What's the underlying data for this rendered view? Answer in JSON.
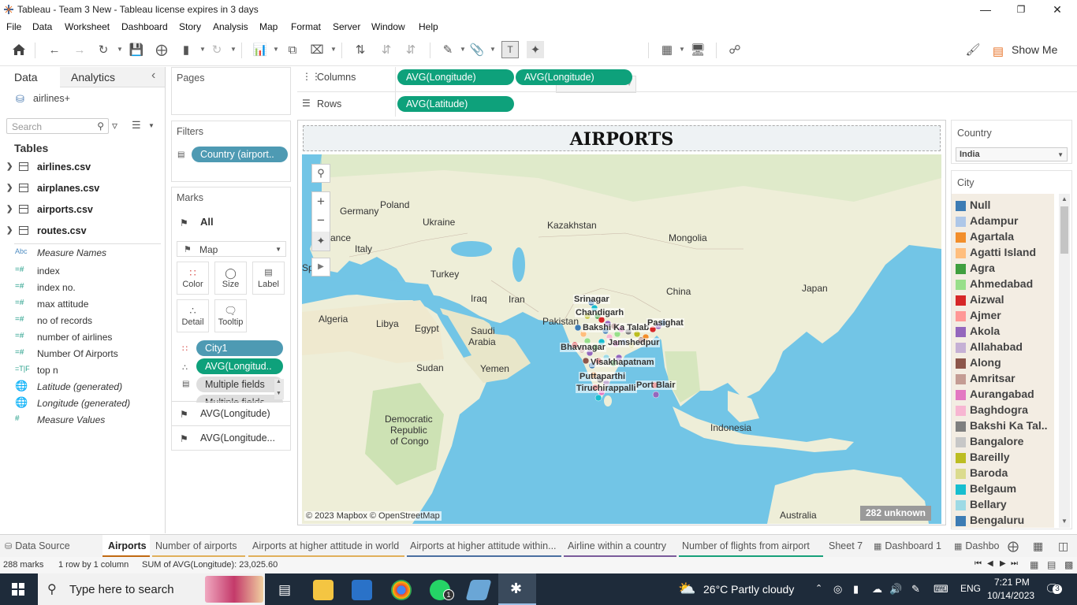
{
  "window": {
    "title": "Tableau - Team 3 New - Tableau license expires in 3 days",
    "minimize": "—",
    "restore": "❐",
    "close": "✕"
  },
  "menu": [
    "File",
    "Data",
    "Worksheet",
    "Dashboard",
    "Story",
    "Analysis",
    "Map",
    "Format",
    "Server",
    "Window",
    "Help"
  ],
  "toolbar": {
    "show_me_label": "Show Me"
  },
  "data_pane": {
    "tab_data": "Data",
    "tab_analytics": "Analytics",
    "collapse": "‹",
    "datasource": "airlines+",
    "search_placeholder": "Search",
    "tables_heading": "Tables",
    "tables": [
      "airlines.csv",
      "airplanes.csv",
      "airports.csv",
      "routes.csv"
    ],
    "fields": [
      {
        "icon": "Abc",
        "name": "Measure Names",
        "italic": true
      },
      {
        "icon": "=#",
        "name": "index",
        "italic": false
      },
      {
        "icon": "=#",
        "name": "index no.",
        "italic": false
      },
      {
        "icon": "=#",
        "name": "max attitude",
        "italic": false
      },
      {
        "icon": "=#",
        "name": "no of records",
        "italic": false
      },
      {
        "icon": "=#",
        "name": "number of airlines",
        "italic": false
      },
      {
        "icon": "=#",
        "name": "Number Of Airports",
        "italic": false
      },
      {
        "icon": "=T|F",
        "name": "top  n",
        "italic": false
      },
      {
        "icon": "globe",
        "name": "Latitude (generated)",
        "italic": true
      },
      {
        "icon": "globe",
        "name": "Longitude (generated)",
        "italic": true
      },
      {
        "icon": "#",
        "name": "Measure Values",
        "italic": true
      }
    ]
  },
  "shelves": {
    "pages_label": "Pages",
    "filters_label": "Filters",
    "filter_pill": "Country (airport..",
    "marks_label": "Marks",
    "marks_all": "All",
    "mark_type": "Map",
    "mark_buttons": [
      "Color",
      "Size",
      "Label",
      "Detail",
      "Tooltip"
    ],
    "mark_pills": [
      "City1",
      "AVG(Longitud..",
      "Multiple fields",
      "Multiple fields"
    ],
    "mark_layers": [
      "AVG(Longitude)",
      "AVG(Longitude..."
    ],
    "columns_label": "Columns",
    "columns_pills": [
      "AVG(Longitude)",
      "AVG(Longitude)"
    ],
    "rows_label": "Rows",
    "rows_pills": [
      "AVG(Latitude)"
    ]
  },
  "viz": {
    "title": "AIRPORTS",
    "attribution": "© 2023 Mapbox © OpenStreetMap",
    "unknown": "282 unknown",
    "map_labels": [
      "Germany",
      "Poland",
      "Ukraine",
      "Kazakhstan",
      "Mongolia",
      "ance",
      "Italy",
      "Sp",
      "Turkey",
      "Iraq",
      "Iran",
      "China",
      "Japan",
      "Algeria",
      "Libya",
      "Egypt",
      "Saudi",
      "Arabia",
      "Pakistan",
      "Sudan",
      "Yemen",
      "Democratic",
      "Republic",
      "of Congo",
      "Indonesia",
      "Australia"
    ],
    "city_labels": [
      "Srinagar",
      "Chandigarh",
      "Bakshi Ka Talab",
      "Pasighat",
      "Bhavnagar",
      "Jamshedpur",
      "Visakhapatnam",
      "Puttaparthi",
      "Tiruchirappalli",
      "Port Blair"
    ]
  },
  "legend": {
    "country_title": "Country",
    "country_value": "India",
    "city_title": "City",
    "cities": [
      {
        "name": "Null",
        "color": "#3d7cb4"
      },
      {
        "name": "Adampur",
        "color": "#aec7e8"
      },
      {
        "name": "Agartala",
        "color": "#f28e2b"
      },
      {
        "name": "Agatti Island",
        "color": "#ffbe7d"
      },
      {
        "name": "Agra",
        "color": "#3f9f3f"
      },
      {
        "name": "Ahmedabad",
        "color": "#98df8a"
      },
      {
        "name": "Aizwal",
        "color": "#d62728"
      },
      {
        "name": "Ajmer",
        "color": "#ff9896"
      },
      {
        "name": "Akola",
        "color": "#9467bd"
      },
      {
        "name": "Allahabad",
        "color": "#c5b0d5"
      },
      {
        "name": "Along",
        "color": "#8c564b"
      },
      {
        "name": "Amritsar",
        "color": "#c49c94"
      },
      {
        "name": "Aurangabad",
        "color": "#e377c2"
      },
      {
        "name": "Baghdogra",
        "color": "#f7b6d2"
      },
      {
        "name": "Bakshi Ka Tal..",
        "color": "#7f7f7f"
      },
      {
        "name": "Bangalore",
        "color": "#c7c7c7"
      },
      {
        "name": "Bareilly",
        "color": "#bcbd22"
      },
      {
        "name": "Baroda",
        "color": "#dbdb8d"
      },
      {
        "name": "Belgaum",
        "color": "#17becf"
      },
      {
        "name": "Bellary",
        "color": "#9edae5"
      },
      {
        "name": "Bengaluru",
        "color": "#3d7cb4"
      }
    ]
  },
  "tabs": [
    {
      "label": "Data Source",
      "color": "#c16a12",
      "active": false
    },
    {
      "label": "Airports",
      "color": "#c16a12",
      "active": true
    },
    {
      "label": "Number of airports",
      "color": "#e0b05a",
      "active": false
    },
    {
      "label": "Airports at higher attitude in world",
      "color": "#e0b05a",
      "active": false
    },
    {
      "label": "Airports at higher attitude within...",
      "color": "#4a6fa0",
      "active": false
    },
    {
      "label": "Airline within a country",
      "color": "#7a5a9a",
      "active": false
    },
    {
      "label": "Number of flights from airport",
      "color": "#17a07a",
      "active": false
    },
    {
      "label": "Sheet 7",
      "color": "#f3f3f3",
      "active": false
    },
    {
      "label": "Dashboard 1",
      "color": "#f3f3f3",
      "active": false
    },
    {
      "label": "Dashbo",
      "color": "#f3f3f3",
      "active": false
    }
  ],
  "status": {
    "marks": "288 marks",
    "rows_cols": "1 row by 1 column",
    "sum": "SUM of AVG(Longitude): 23,025.60"
  },
  "taskbar": {
    "search_placeholder": "Type here to search",
    "weather": "26°C  Partly cloudy",
    "lang": "ENG",
    "time": "7:21 PM",
    "date": "10/14/2023",
    "notifications": "3",
    "whatsapp_badge": "1"
  }
}
